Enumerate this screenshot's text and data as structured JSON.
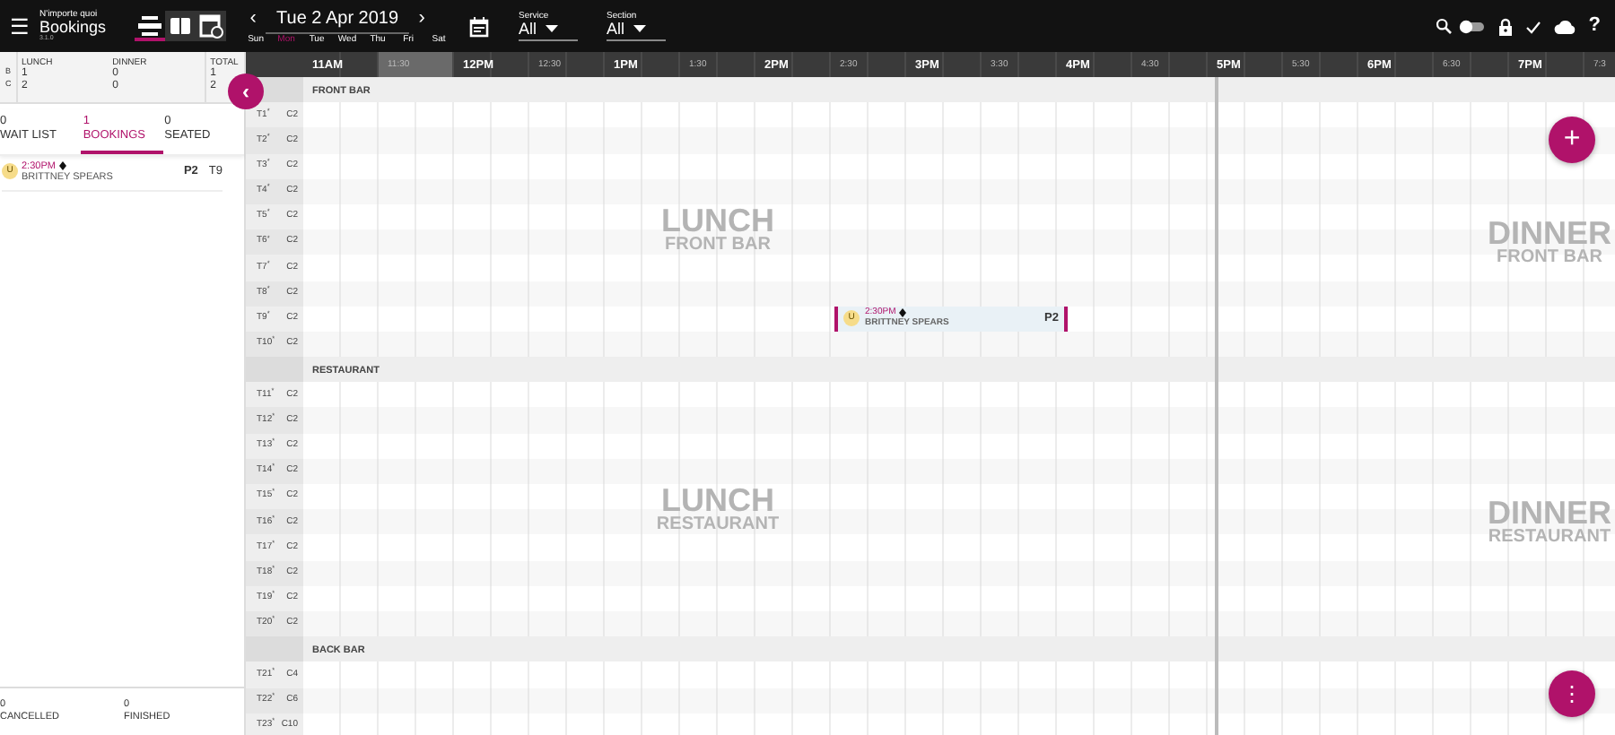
{
  "app": {
    "org": "N'importe quoi",
    "title": "Bookings",
    "version": "3.1.0",
    "menu": "☰"
  },
  "views": [
    {
      "kind": "timeline",
      "selected": true
    },
    {
      "kind": "book",
      "selected": false
    },
    {
      "kind": "calendar",
      "selected": false
    }
  ],
  "date": {
    "prev": "‹",
    "label": "Tue 2 Apr 2019",
    "next": "›"
  },
  "weekdays": [
    {
      "label": "Sun",
      "selected": false
    },
    {
      "label": "Mon",
      "selected": true
    },
    {
      "label": "Tue",
      "selected": false
    },
    {
      "label": "Wed",
      "selected": false
    },
    {
      "label": "Thu",
      "selected": false
    },
    {
      "label": "Fri",
      "selected": false
    },
    {
      "label": "Sat",
      "selected": false
    }
  ],
  "filters": [
    {
      "label": "Service",
      "value": "All"
    },
    {
      "label": "Section",
      "value": "All"
    }
  ],
  "toolbar": {
    "toggle_on": false,
    "help": "?"
  },
  "summary": {
    "columns": [
      "LUNCH",
      "DINNER",
      "TOTAL"
    ],
    "rows": [
      {
        "label": "B",
        "values": [
          "1",
          "0",
          "1"
        ]
      },
      {
        "label": "C",
        "values": [
          "2",
          "0",
          "2"
        ]
      }
    ]
  },
  "tabs": [
    {
      "count": "0",
      "label": "WAIT LIST",
      "selected": false
    },
    {
      "count": "1",
      "label": "BOOKINGS",
      "selected": true
    },
    {
      "count": "0",
      "label": "SEATED",
      "selected": false
    }
  ],
  "bookings": [
    {
      "badge": "U",
      "time": "2:30PM",
      "name": "BRITTNEY SPEARS",
      "party": "P2",
      "table": "T9"
    }
  ],
  "footer_counts": [
    {
      "count": "0",
      "label": "CANCELLED"
    },
    {
      "count": "0",
      "label": "FINISHED"
    }
  ],
  "timeline": {
    "times": [
      {
        "label": "11AM",
        "kind": "hour",
        "highlighted": false
      },
      {
        "label": "11:30",
        "kind": "half",
        "highlighted": true
      },
      {
        "label": "12PM",
        "kind": "hour",
        "highlighted": false
      },
      {
        "label": "12:30",
        "kind": "half",
        "highlighted": false
      },
      {
        "label": "1PM",
        "kind": "hour",
        "highlighted": false
      },
      {
        "label": "1:30",
        "kind": "half",
        "highlighted": false
      },
      {
        "label": "2PM",
        "kind": "hour",
        "highlighted": false
      },
      {
        "label": "2:30",
        "kind": "half",
        "highlighted": false
      },
      {
        "label": "3PM",
        "kind": "hour",
        "highlighted": false
      },
      {
        "label": "3:30",
        "kind": "half",
        "highlighted": false
      },
      {
        "label": "4PM",
        "kind": "hour",
        "highlighted": false
      },
      {
        "label": "4:30",
        "kind": "half",
        "highlighted": false
      },
      {
        "label": "5PM",
        "kind": "hour",
        "highlighted": false
      },
      {
        "label": "5:30",
        "kind": "half",
        "highlighted": false
      },
      {
        "label": "6PM",
        "kind": "hour",
        "highlighted": false
      },
      {
        "label": "6:30",
        "kind": "half",
        "highlighted": false
      },
      {
        "label": "7PM",
        "kind": "hour",
        "highlighted": false
      },
      {
        "label": "7:3",
        "kind": "half",
        "highlighted": false
      }
    ],
    "sections": [
      {
        "name": "FRONT BAR",
        "watermarks": [
          {
            "service": "LUNCH",
            "area": "FRONT BAR"
          },
          {
            "service": "DINNER",
            "area": "FRONT BAR"
          }
        ],
        "tables": [
          {
            "name": "T1$^{*}$",
            "capacity": "C2"
          },
          {
            "name": "T2$^{*}$",
            "capacity": "C2"
          },
          {
            "name": "T3$^{*}$",
            "capacity": "C2"
          },
          {
            "name": "T4$^{*}$",
            "capacity": "C2"
          },
          {
            "name": "T5$^{*}$",
            "capacity": "C2"
          },
          {
            "name": "T6$^{*}$",
            "capacity": "C2"
          },
          {
            "name": "T7$^{*}$",
            "capacity": "C2"
          },
          {
            "name": "T8$^{*}$",
            "capacity": "C2"
          },
          {
            "name": "T9$^{*}$",
            "capacity": "C2",
            "bookings": [
              {
                "badge": "U",
                "time": "2:30PM",
                "name": "BRITTNEY SPEARS",
                "party": "P2"
              }
            ]
          },
          {
            "name": "T10$^{*}$",
            "capacity": "C2"
          }
        ]
      },
      {
        "name": "RESTAURANT",
        "watermarks": [
          {
            "service": "LUNCH",
            "area": "RESTAURANT"
          },
          {
            "service": "DINNER",
            "area": "RESTAURANT"
          }
        ],
        "tables": [
          {
            "name": "T11$^{*}$",
            "capacity": "C2"
          },
          {
            "name": "T12$^{*}$",
            "capacity": "C2"
          },
          {
            "name": "T13$^{*}$",
            "capacity": "C2"
          },
          {
            "name": "T14$^{*}$",
            "capacity": "C2"
          },
          {
            "name": "T15$^{*}$",
            "capacity": "C2"
          },
          {
            "name": "T16$^{*}$",
            "capacity": "C2"
          },
          {
            "name": "T17$^{*}$",
            "capacity": "C2"
          },
          {
            "name": "T18$^{*}$",
            "capacity": "C2"
          },
          {
            "name": "T19$^{*}$",
            "capacity": "C2"
          },
          {
            "name": "T20$^{*}$",
            "capacity": "C2"
          }
        ]
      },
      {
        "name": "BACK BAR",
        "tables": [
          {
            "name": "T21$^{*}$",
            "capacity": "C4"
          },
          {
            "name": "T22$^{*}$",
            "capacity": "C6"
          },
          {
            "name": "T23$^{*}$",
            "capacity": "C10"
          }
        ]
      }
    ]
  },
  "fabs": [
    {
      "kind": "add",
      "label": "+"
    },
    {
      "kind": "more",
      "label": "⋮"
    }
  ],
  "collapse": {
    "label": "‹"
  }
}
